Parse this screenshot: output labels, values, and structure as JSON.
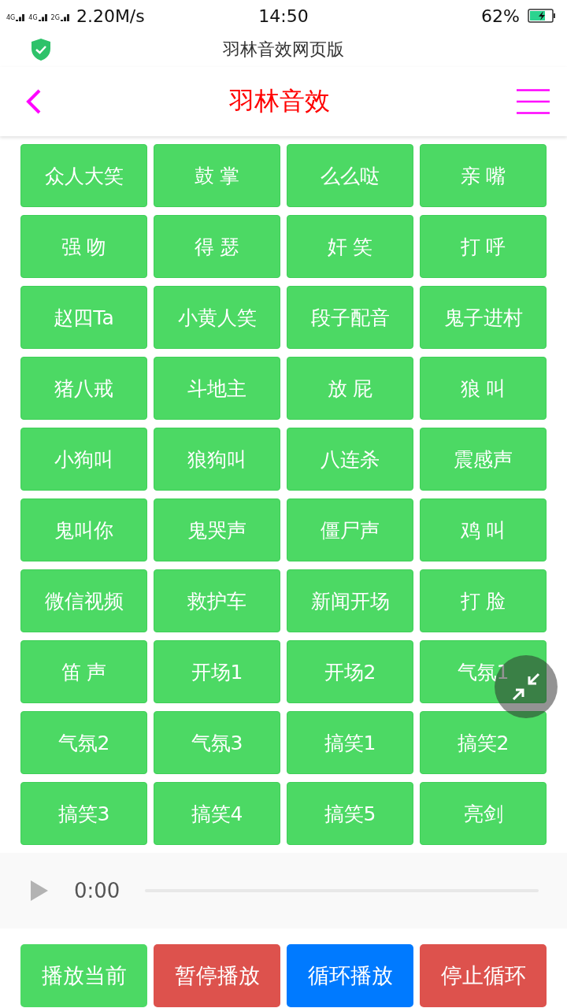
{
  "status_bar": {
    "network_labels": [
      "4G",
      "4G",
      "2G"
    ],
    "speed": "2.20M/s",
    "time": "14:50",
    "battery": "62%"
  },
  "browser": {
    "title": "羽林音效网页版"
  },
  "header": {
    "title": "羽林音效"
  },
  "sounds": [
    "众人大笑",
    "鼓 掌",
    "么么哒",
    "亲 嘴",
    "强 吻",
    "得 瑟",
    "奸 笑",
    "打 呼",
    "赵四Ta",
    "小黄人笑",
    "段子配音",
    "鬼子进村",
    "猪八戒",
    "斗地主",
    "放 屁",
    "狼 叫",
    "小狗叫",
    "狼狗叫",
    "八连杀",
    "震感声",
    "鬼叫你",
    "鬼哭声",
    "僵尸声",
    "鸡 叫",
    "微信视频",
    "救护车",
    "新闻开场",
    "打 脸",
    "笛 声",
    "开场1",
    "开场2",
    "气氛1",
    "气氛2",
    "气氛3",
    "搞笑1",
    "搞笑2",
    "搞笑3",
    "搞笑4",
    "搞笑5",
    "亮剑"
  ],
  "player": {
    "time": "0:00"
  },
  "actions": [
    {
      "label": "播放当前",
      "color": "#4cd964"
    },
    {
      "label": "暂停播放",
      "color": "#dd524d"
    },
    {
      "label": "循环播放",
      "color": "#007aff"
    },
    {
      "label": "停止循环",
      "color": "#dd524d"
    }
  ]
}
